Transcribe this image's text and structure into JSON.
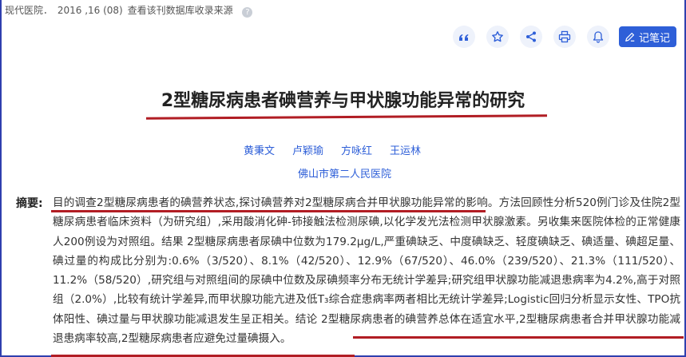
{
  "source": {
    "journal": "现代医院．",
    "issue": "2016 ,16 (08)",
    "link": "查看该刊数据库收录来源",
    "help_glyph": "?"
  },
  "toolbar": {
    "icons": [
      "quote-icon",
      "star-icon",
      "share-icon",
      "print-icon",
      "bell-icon"
    ],
    "note_label": "记笔记",
    "accent": "#2e5fd8"
  },
  "article": {
    "title": "2型糖尿病患者碘营养与甲状腺功能异常的研究",
    "authors": [
      "黄秉文",
      "卢颖瑜",
      "方咏红",
      "王运林"
    ],
    "organization": "佛山市第二人民医院"
  },
  "abstract": {
    "label": "摘要:",
    "text": "目的调查2型糖尿病患者的碘营养状态,探讨碘营养对2型糖尿病合并甲状腺功能异常的影响。方法回顾性分析520例门诊及住院2型糖尿病患者临床资料（为研究组）,采用酸消化砷-铈接触法检测尿碘,以化学发光法检测甲状腺激素。另收集来医院体检的正常健康人200例设为对照组。结果 2型糖尿病患者尿碘中位数为179.2μg/L,严重碘缺乏、中度碘缺乏、轻度碘缺乏、碘适量、碘超足量、碘过量的构成比分别为:0.6%（3/520）、8.1%（42/520）、12.9%（67/520）、46.0%（239/520）、21.3%（111/520）、11.2%（58/520）,研究组与对照组间的尿碘中位数及尿碘频率分布无统计学差异;研究组甲状腺功能减退患病率为4.2%,高于对照组（2.0%）,比较有统计学差异,而甲状腺功能亢进及低T₃综合症患病率两者相比无统计学差异;Logistic回归分析显示女性、TPO抗体阳性、碘过量与甲状腺功能减退发生呈正相关。结论 2型糖尿病患者的碘营养总体在适宜水平,2型糖尿病患者合并甲状腺功能减退患病率较高,2型糖尿病患者应避免过量碘摄入。"
  },
  "colors": {
    "highlight": "#b11d24",
    "frame": "#2f3fae",
    "link": "#2e5fd8"
  }
}
